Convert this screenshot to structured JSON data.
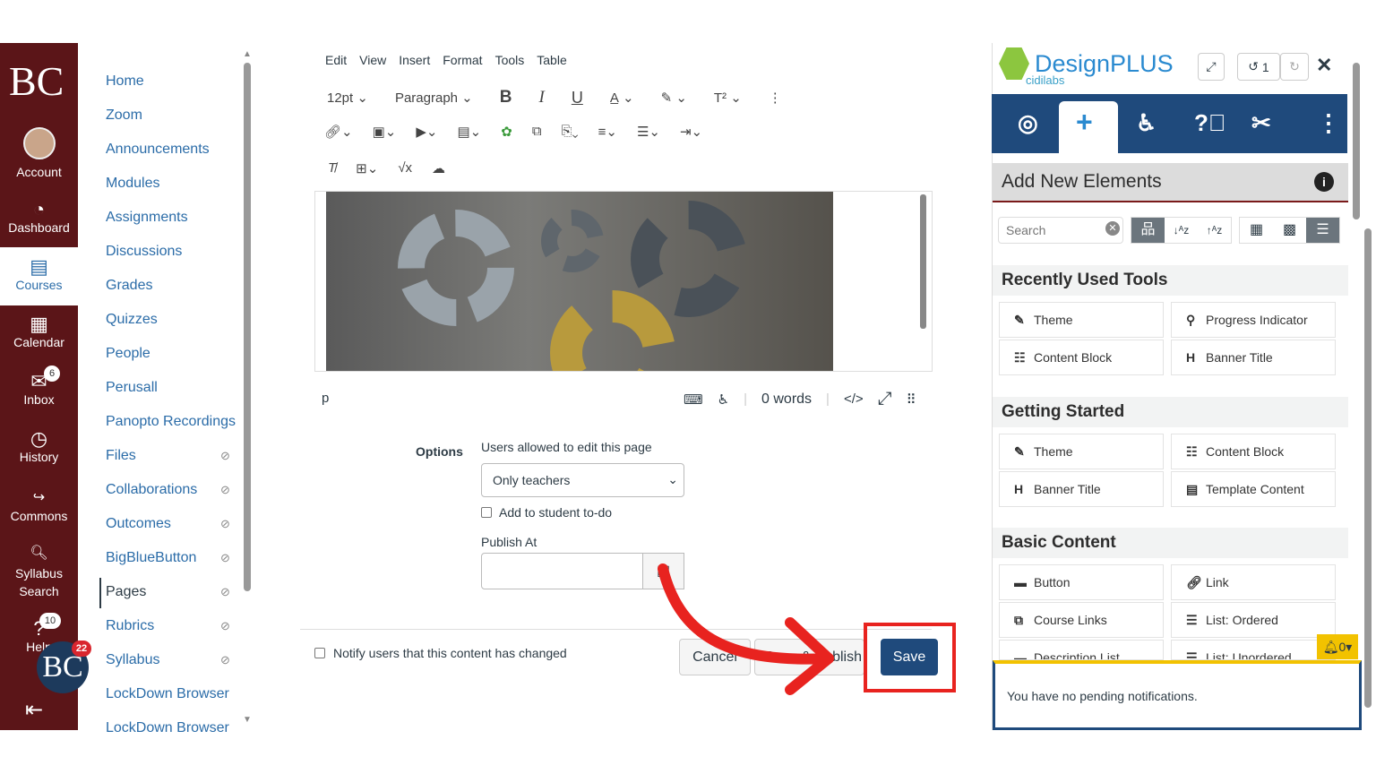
{
  "global_nav": {
    "logo": "BC",
    "items": [
      {
        "label": "Account",
        "icon": "avatar"
      },
      {
        "label": "Dashboard",
        "icon": "dashboard-icon"
      },
      {
        "label": "Courses",
        "icon": "courses-icon"
      },
      {
        "label": "Calendar",
        "icon": "calendar-icon"
      },
      {
        "label": "Inbox",
        "icon": "inbox-icon",
        "badge": "6"
      },
      {
        "label": "History",
        "icon": "clock-icon"
      },
      {
        "label": "Commons",
        "icon": "commons-icon"
      },
      {
        "label": "Syllabus Search",
        "icon": "syllabus-search-icon"
      },
      {
        "label": "Help",
        "icon": "help-icon",
        "badge": "10"
      }
    ],
    "bc_badge": "22",
    "bc_logo": "BC",
    "colors": {
      "bg": "#5b1518",
      "active_bg": "#ffffff"
    }
  },
  "course_nav": {
    "items": [
      {
        "label": "Home"
      },
      {
        "label": "Zoom"
      },
      {
        "label": "Announcements"
      },
      {
        "label": "Modules"
      },
      {
        "label": "Assignments"
      },
      {
        "label": "Discussions"
      },
      {
        "label": "Grades"
      },
      {
        "label": "Quizzes"
      },
      {
        "label": "People"
      },
      {
        "label": "Perusall"
      },
      {
        "label": "Panopto Recordings"
      },
      {
        "label": "Files",
        "hidden": true
      },
      {
        "label": "Collaborations",
        "hidden": true
      },
      {
        "label": "Outcomes",
        "hidden": true
      },
      {
        "label": "BigBlueButton",
        "hidden": true
      },
      {
        "label": "Pages",
        "hidden": true,
        "active": true
      },
      {
        "label": "Rubrics",
        "hidden": true
      },
      {
        "label": "Syllabus",
        "hidden": true
      },
      {
        "label": "LockDown Browser"
      },
      {
        "label": "LockDown Browser"
      }
    ]
  },
  "editor": {
    "menu": [
      "Edit",
      "View",
      "Insert",
      "Format",
      "Tools",
      "Table"
    ],
    "font_size": "12pt",
    "block": "Paragraph",
    "status_tag": "p",
    "word_count": "0 words",
    "code_toggle": "</>"
  },
  "options": {
    "label": "Options",
    "edit_label": "Users allowed to edit this page",
    "edit_value": "Only teachers",
    "todo_label": "Add to student to-do",
    "publish_at_label": "Publish At",
    "publish_at_value": "",
    "notify_label": "Notify users that this content has changed"
  },
  "actions": {
    "cancel": "Cancel",
    "publish": "Save & Publish",
    "save": "Save"
  },
  "designplus": {
    "brand": "DesignPLUS",
    "sub": "cidilabs",
    "undo_count": "1",
    "section_title": "Add New Elements",
    "search_placeholder": "Search",
    "sections": [
      {
        "title": "Recently Used Tools",
        "tools": [
          {
            "label": "Theme",
            "icon": "wand-icon"
          },
          {
            "label": "Progress Indicator",
            "icon": "map-pin-icon"
          },
          {
            "label": "Content Block",
            "icon": "table-icon"
          },
          {
            "label": "Banner Title",
            "icon": "heading-icon"
          }
        ]
      },
      {
        "title": "Getting Started",
        "tools": [
          {
            "label": "Theme",
            "icon": "wand-icon"
          },
          {
            "label": "Content Block",
            "icon": "table-icon"
          },
          {
            "label": "Banner Title",
            "icon": "heading-icon"
          },
          {
            "label": "Template Content",
            "icon": "file-icon"
          }
        ]
      },
      {
        "title": "Basic Content",
        "tools": [
          {
            "label": "Button",
            "icon": "button-icon"
          },
          {
            "label": "Link",
            "icon": "link-icon"
          },
          {
            "label": "Course Links",
            "icon": "course-links-icon"
          },
          {
            "label": "List: Ordered",
            "icon": "ordered-list-icon"
          },
          {
            "label": "Description List",
            "icon": "description-icon"
          },
          {
            "label": "List: Unordered",
            "icon": "unordered-list-icon"
          }
        ]
      }
    ],
    "notif_count": "0",
    "notif_text": "You have no pending notifications.",
    "colors": {
      "tabbar": "#1f4a7c",
      "accent": "#2a8ad0",
      "highlight": "#e8231f"
    }
  }
}
